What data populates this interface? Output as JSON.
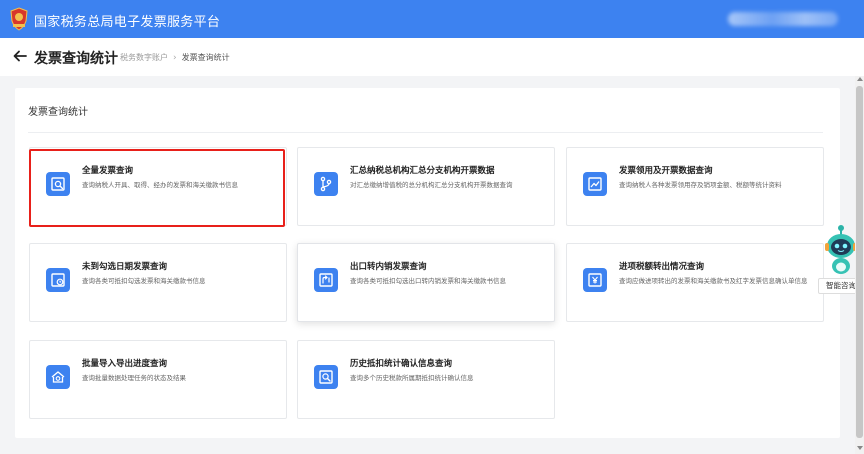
{
  "app": {
    "title": "国家税务总局电子发票服务平台",
    "colors": {
      "brand": "#3d82f0",
      "highlight": "#e8201a"
    }
  },
  "header": {
    "page_title": "发票查询统计",
    "breadcrumb": [
      "税务数字账户",
      "发票查询统计"
    ],
    "back_icon": "arrow-left-icon"
  },
  "section": {
    "title": "发票查询统计"
  },
  "cards": [
    {
      "title": "全量发票查询",
      "desc": "查询纳税人开具、取得、经办的发票和海关缴款书信息",
      "icon": "invoice-search-icon"
    },
    {
      "title": "汇总纳税总机构汇总分支机构开票数据",
      "desc": "对汇总缴纳增值税的总分机构汇总分支机构开票数据查询",
      "icon": "branch-tree-icon"
    },
    {
      "title": "发票领用及开票数据查询",
      "desc": "查询纳税人各种发票领用存及销项金额、税额等统计资料",
      "icon": "trend-chart-icon"
    },
    {
      "title": "未到勾选日期发票查询",
      "desc": "查询各类可抵扣勾选发票和海关缴款书信息",
      "icon": "clock-doc-icon"
    },
    {
      "title": "出口转内销发票查询",
      "desc": "查询各类可抵扣勾选出口转内销发票和海关缴款书信息",
      "icon": "transfer-doc-icon"
    },
    {
      "title": "进项税额转出情况查询",
      "desc": "查询应做进项转出的发票和海关缴款书及红字发票信息确认单信息",
      "icon": "yuan-doc-icon"
    },
    {
      "title": "批量导入导出进度查询",
      "desc": "查询批量数据处理任务的状态及结果",
      "icon": "batch-progress-icon"
    },
    {
      "title": "历史抵扣统计确认信息查询",
      "desc": "查询多个历史税款所属期抵扣统计确认信息",
      "icon": "history-search-icon"
    }
  ],
  "assistant": {
    "label": "智能咨询",
    "icon": "robot-assistant-icon"
  }
}
